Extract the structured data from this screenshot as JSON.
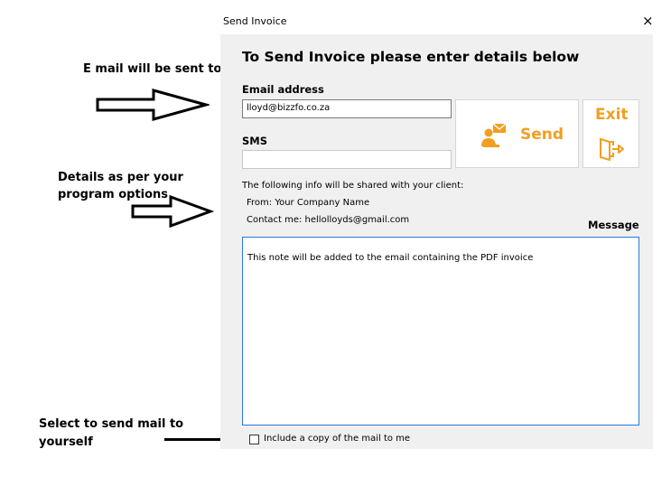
{
  "annotations": {
    "email_note": "E mail will be sent to",
    "details_line1": "Details as per your",
    "details_line2": "program options",
    "select_line1": "Select to send mail to",
    "select_line2": "yourself"
  },
  "dialog": {
    "title": "Send Invoice",
    "close_glyph": "×",
    "heading": "To Send Invoice please enter details below",
    "email_label": "Email address",
    "email_value": "lloyd@bizzfo.co.za",
    "sms_label": "SMS",
    "sms_value": "",
    "send_label": "Send",
    "exit_label": "Exit",
    "info_intro": "The following info will be shared with your client:",
    "info_from": "From: Your Company Name",
    "info_contact": "Contact me: hellolloyds@gmail.com",
    "message_label": "Message",
    "message_text": "This note will be added to the email containing the PDF invoice",
    "copy_label": "Include a copy of the mail to me",
    "copy_checked": false
  },
  "colors": {
    "accent": "#f29f1f",
    "panel_bg": "#f0f0f0",
    "focus_border": "#2b79d6"
  },
  "icons": {
    "send": "person-mail-icon",
    "exit": "door-exit-icon"
  }
}
